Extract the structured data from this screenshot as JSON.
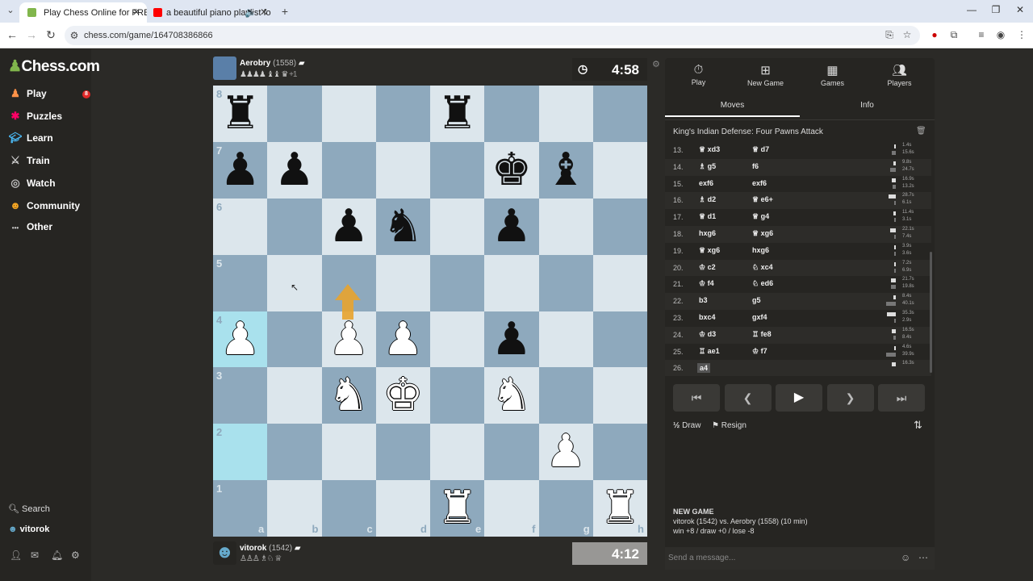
{
  "browser": {
    "tabs": [
      {
        "title": "Play Chess Online for FREE - 2 P",
        "active": true
      },
      {
        "title": "a beautiful piano playlist fo",
        "active": false
      }
    ],
    "url": "chess.com/game/164708386866"
  },
  "sidebar": {
    "logo": {
      "mark": "♟",
      "text": "Chess.com"
    },
    "items": [
      {
        "label": "Play",
        "icon": "pawn-icon",
        "badge": "8"
      },
      {
        "label": "Puzzles",
        "icon": "puzzle-icon"
      },
      {
        "label": "Learn",
        "icon": "learn-icon"
      },
      {
        "label": "Train",
        "icon": "train-icon"
      },
      {
        "label": "Watch",
        "icon": "watch-icon"
      },
      {
        "label": "Community",
        "icon": "community-icon"
      },
      {
        "label": "Other",
        "icon": "more-icon"
      }
    ],
    "search": "Search",
    "user": "vitorok"
  },
  "top_player": {
    "name": "Aerobry",
    "rating": "(1558)",
    "captured": "♟♟♟♟ ♝♝ ♛",
    "diff": "+1"
  },
  "bottom_player": {
    "name": "vitorok",
    "rating": "(1542)",
    "captured": "♙♙♙ ♗♘ ♕"
  },
  "clocks": {
    "top": "4:58",
    "bottom": "4:12"
  },
  "board": {
    "ranks": [
      "8",
      "7",
      "6",
      "5",
      "4",
      "3",
      "2",
      "1"
    ],
    "files": [
      "a",
      "b",
      "c",
      "d",
      "e",
      "f",
      "g",
      "h"
    ],
    "pieces": [
      {
        "sq": "a8",
        "c": "black",
        "g": "♜"
      },
      {
        "sq": "e8",
        "c": "black",
        "g": "♜"
      },
      {
        "sq": "a7",
        "c": "black",
        "g": "♟"
      },
      {
        "sq": "b7",
        "c": "black",
        "g": "♟"
      },
      {
        "sq": "f7",
        "c": "black",
        "g": "♚"
      },
      {
        "sq": "g7",
        "c": "black",
        "g": "♝"
      },
      {
        "sq": "c6",
        "c": "black",
        "g": "♟"
      },
      {
        "sq": "d6",
        "c": "black",
        "g": "♞"
      },
      {
        "sq": "f6",
        "c": "black",
        "g": "♟"
      },
      {
        "sq": "a4",
        "c": "white",
        "g": "♟"
      },
      {
        "sq": "c4",
        "c": "white",
        "g": "♟"
      },
      {
        "sq": "d4",
        "c": "white",
        "g": "♟"
      },
      {
        "sq": "f4",
        "c": "black",
        "g": "♟"
      },
      {
        "sq": "c3",
        "c": "white",
        "g": "♞"
      },
      {
        "sq": "d3",
        "c": "white",
        "g": "♚"
      },
      {
        "sq": "f3",
        "c": "white",
        "g": "♞"
      },
      {
        "sq": "g2",
        "c": "white",
        "g": "♟"
      },
      {
        "sq": "e1",
        "c": "white",
        "g": "♜"
      },
      {
        "sq": "h1",
        "c": "white",
        "g": "♜"
      }
    ],
    "highlights": [
      "a2",
      "a4"
    ]
  },
  "panel": {
    "tabs": [
      {
        "label": "Play",
        "icon": "clock-icon"
      },
      {
        "label": "New Game",
        "icon": "plus-icon"
      },
      {
        "label": "Games",
        "icon": "board-icon"
      },
      {
        "label": "Players",
        "icon": "players-icon"
      }
    ],
    "subtabs": [
      "Moves",
      "Info"
    ],
    "opening": "King's Indian Defense: Four Pawns Attack",
    "moves": [
      {
        "n": "13.",
        "w": "♕ xd3",
        "b": "♕ d7",
        "tw": "1.4s",
        "tb": "15.6s",
        "fw": 0.05,
        "fb": 0.39
      },
      {
        "n": "14.",
        "w": "♗ g5",
        "b": "f6",
        "tw": "9.8s",
        "tb": "24.7s",
        "fw": 0.25,
        "fb": 0.62
      },
      {
        "n": "15.",
        "w": "exf6",
        "b": "exf6",
        "tw": "16.9s",
        "tb": "13.2s",
        "fw": 0.42,
        "fb": 0.33
      },
      {
        "n": "16.",
        "w": "♗ d2",
        "b": "♕ e6+",
        "tw": "28.7s",
        "tb": "6.1s",
        "fw": 0.72,
        "fb": 0.15
      },
      {
        "n": "17.",
        "w": "♕ d1",
        "b": "♕ g4",
        "tw": "11.4s",
        "tb": "3.1s",
        "fw": 0.28,
        "fb": 0.08
      },
      {
        "n": "18.",
        "w": "hxg6",
        "b": "♕ xg6",
        "tw": "22.1s",
        "tb": "7.4s",
        "fw": 0.55,
        "fb": 0.18
      },
      {
        "n": "19.",
        "w": "♕ xg6",
        "b": "hxg6",
        "tw": "3.9s",
        "tb": "3.6s",
        "fw": 0.1,
        "fb": 0.09
      },
      {
        "n": "20.",
        "w": "♔ c2",
        "b": "♘ xc4",
        "tw": "7.2s",
        "tb": "6.9s",
        "fw": 0.18,
        "fb": 0.17
      },
      {
        "n": "21.",
        "w": "♔ f4",
        "b": "♘ ed6",
        "tw": "21.7s",
        "tb": "19.8s",
        "fw": 0.54,
        "fb": 0.5
      },
      {
        "n": "22.",
        "w": "b3",
        "b": "g5",
        "tw": "8.4s",
        "tb": "40.1s",
        "fw": 0.21,
        "fb": 1.0
      },
      {
        "n": "23.",
        "w": "bxc4",
        "b": "gxf4",
        "tw": "35.3s",
        "tb": "2.9s",
        "fw": 0.88,
        "fb": 0.07
      },
      {
        "n": "24.",
        "w": "♔ d3",
        "b": "♖ fe8",
        "tw": "16.5s",
        "tb": "8.4s",
        "fw": 0.41,
        "fb": 0.21
      },
      {
        "n": "25.",
        "w": "♖ ae1",
        "b": "♔ f7",
        "tw": "4.6s",
        "tb": "39.9s",
        "fw": 0.11,
        "fb": 0.99
      },
      {
        "n": "26.",
        "w": "a4",
        "b": "",
        "tw": "16.3s",
        "tb": "",
        "fw": 0.41,
        "fb": 0
      }
    ],
    "controls": [
      {
        "g": "⏮",
        "name": "first-move-button"
      },
      {
        "g": "❮",
        "name": "prev-move-button"
      },
      {
        "g": "▶",
        "name": "play-button"
      },
      {
        "g": "❯",
        "name": "next-move-button"
      },
      {
        "g": "⏭",
        "name": "last-move-button"
      }
    ],
    "draw": "Draw",
    "draw_icon": "½",
    "resign": "Resign",
    "new_game": {
      "title": "NEW GAME",
      "line1": "vitorok (1542) vs. Aerobry (1558) (10 min)",
      "line2": "win +8 / draw +0 / lose -8"
    },
    "message_placeholder": "Send a message..."
  },
  "colors": {
    "light": "#dce6ec",
    "dark": "#8ea9bd",
    "highlight": "#a9e1ed",
    "brand": "#81b64c"
  }
}
